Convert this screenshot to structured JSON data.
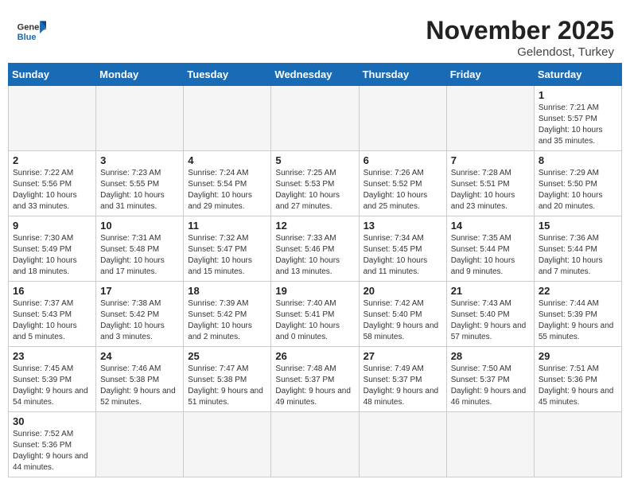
{
  "header": {
    "logo_general": "General",
    "logo_blue": "Blue",
    "month_title": "November 2025",
    "location": "Gelendost, Turkey"
  },
  "weekdays": [
    "Sunday",
    "Monday",
    "Tuesday",
    "Wednesday",
    "Thursday",
    "Friday",
    "Saturday"
  ],
  "weeks": [
    [
      {
        "day": "",
        "info": ""
      },
      {
        "day": "",
        "info": ""
      },
      {
        "day": "",
        "info": ""
      },
      {
        "day": "",
        "info": ""
      },
      {
        "day": "",
        "info": ""
      },
      {
        "day": "",
        "info": ""
      },
      {
        "day": "1",
        "info": "Sunrise: 7:21 AM\nSunset: 5:57 PM\nDaylight: 10 hours and 35 minutes."
      }
    ],
    [
      {
        "day": "2",
        "info": "Sunrise: 7:22 AM\nSunset: 5:56 PM\nDaylight: 10 hours and 33 minutes."
      },
      {
        "day": "3",
        "info": "Sunrise: 7:23 AM\nSunset: 5:55 PM\nDaylight: 10 hours and 31 minutes."
      },
      {
        "day": "4",
        "info": "Sunrise: 7:24 AM\nSunset: 5:54 PM\nDaylight: 10 hours and 29 minutes."
      },
      {
        "day": "5",
        "info": "Sunrise: 7:25 AM\nSunset: 5:53 PM\nDaylight: 10 hours and 27 minutes."
      },
      {
        "day": "6",
        "info": "Sunrise: 7:26 AM\nSunset: 5:52 PM\nDaylight: 10 hours and 25 minutes."
      },
      {
        "day": "7",
        "info": "Sunrise: 7:28 AM\nSunset: 5:51 PM\nDaylight: 10 hours and 23 minutes."
      },
      {
        "day": "8",
        "info": "Sunrise: 7:29 AM\nSunset: 5:50 PM\nDaylight: 10 hours and 20 minutes."
      }
    ],
    [
      {
        "day": "9",
        "info": "Sunrise: 7:30 AM\nSunset: 5:49 PM\nDaylight: 10 hours and 18 minutes."
      },
      {
        "day": "10",
        "info": "Sunrise: 7:31 AM\nSunset: 5:48 PM\nDaylight: 10 hours and 17 minutes."
      },
      {
        "day": "11",
        "info": "Sunrise: 7:32 AM\nSunset: 5:47 PM\nDaylight: 10 hours and 15 minutes."
      },
      {
        "day": "12",
        "info": "Sunrise: 7:33 AM\nSunset: 5:46 PM\nDaylight: 10 hours and 13 minutes."
      },
      {
        "day": "13",
        "info": "Sunrise: 7:34 AM\nSunset: 5:45 PM\nDaylight: 10 hours and 11 minutes."
      },
      {
        "day": "14",
        "info": "Sunrise: 7:35 AM\nSunset: 5:44 PM\nDaylight: 10 hours and 9 minutes."
      },
      {
        "day": "15",
        "info": "Sunrise: 7:36 AM\nSunset: 5:44 PM\nDaylight: 10 hours and 7 minutes."
      }
    ],
    [
      {
        "day": "16",
        "info": "Sunrise: 7:37 AM\nSunset: 5:43 PM\nDaylight: 10 hours and 5 minutes."
      },
      {
        "day": "17",
        "info": "Sunrise: 7:38 AM\nSunset: 5:42 PM\nDaylight: 10 hours and 3 minutes."
      },
      {
        "day": "18",
        "info": "Sunrise: 7:39 AM\nSunset: 5:42 PM\nDaylight: 10 hours and 2 minutes."
      },
      {
        "day": "19",
        "info": "Sunrise: 7:40 AM\nSunset: 5:41 PM\nDaylight: 10 hours and 0 minutes."
      },
      {
        "day": "20",
        "info": "Sunrise: 7:42 AM\nSunset: 5:40 PM\nDaylight: 9 hours and 58 minutes."
      },
      {
        "day": "21",
        "info": "Sunrise: 7:43 AM\nSunset: 5:40 PM\nDaylight: 9 hours and 57 minutes."
      },
      {
        "day": "22",
        "info": "Sunrise: 7:44 AM\nSunset: 5:39 PM\nDaylight: 9 hours and 55 minutes."
      }
    ],
    [
      {
        "day": "23",
        "info": "Sunrise: 7:45 AM\nSunset: 5:39 PM\nDaylight: 9 hours and 54 minutes."
      },
      {
        "day": "24",
        "info": "Sunrise: 7:46 AM\nSunset: 5:38 PM\nDaylight: 9 hours and 52 minutes."
      },
      {
        "day": "25",
        "info": "Sunrise: 7:47 AM\nSunset: 5:38 PM\nDaylight: 9 hours and 51 minutes."
      },
      {
        "day": "26",
        "info": "Sunrise: 7:48 AM\nSunset: 5:37 PM\nDaylight: 9 hours and 49 minutes."
      },
      {
        "day": "27",
        "info": "Sunrise: 7:49 AM\nSunset: 5:37 PM\nDaylight: 9 hours and 48 minutes."
      },
      {
        "day": "28",
        "info": "Sunrise: 7:50 AM\nSunset: 5:37 PM\nDaylight: 9 hours and 46 minutes."
      },
      {
        "day": "29",
        "info": "Sunrise: 7:51 AM\nSunset: 5:36 PM\nDaylight: 9 hours and 45 minutes."
      }
    ],
    [
      {
        "day": "30",
        "info": "Sunrise: 7:52 AM\nSunset: 5:36 PM\nDaylight: 9 hours and 44 minutes."
      },
      {
        "day": "",
        "info": ""
      },
      {
        "day": "",
        "info": ""
      },
      {
        "day": "",
        "info": ""
      },
      {
        "day": "",
        "info": ""
      },
      {
        "day": "",
        "info": ""
      },
      {
        "day": "",
        "info": ""
      }
    ]
  ]
}
